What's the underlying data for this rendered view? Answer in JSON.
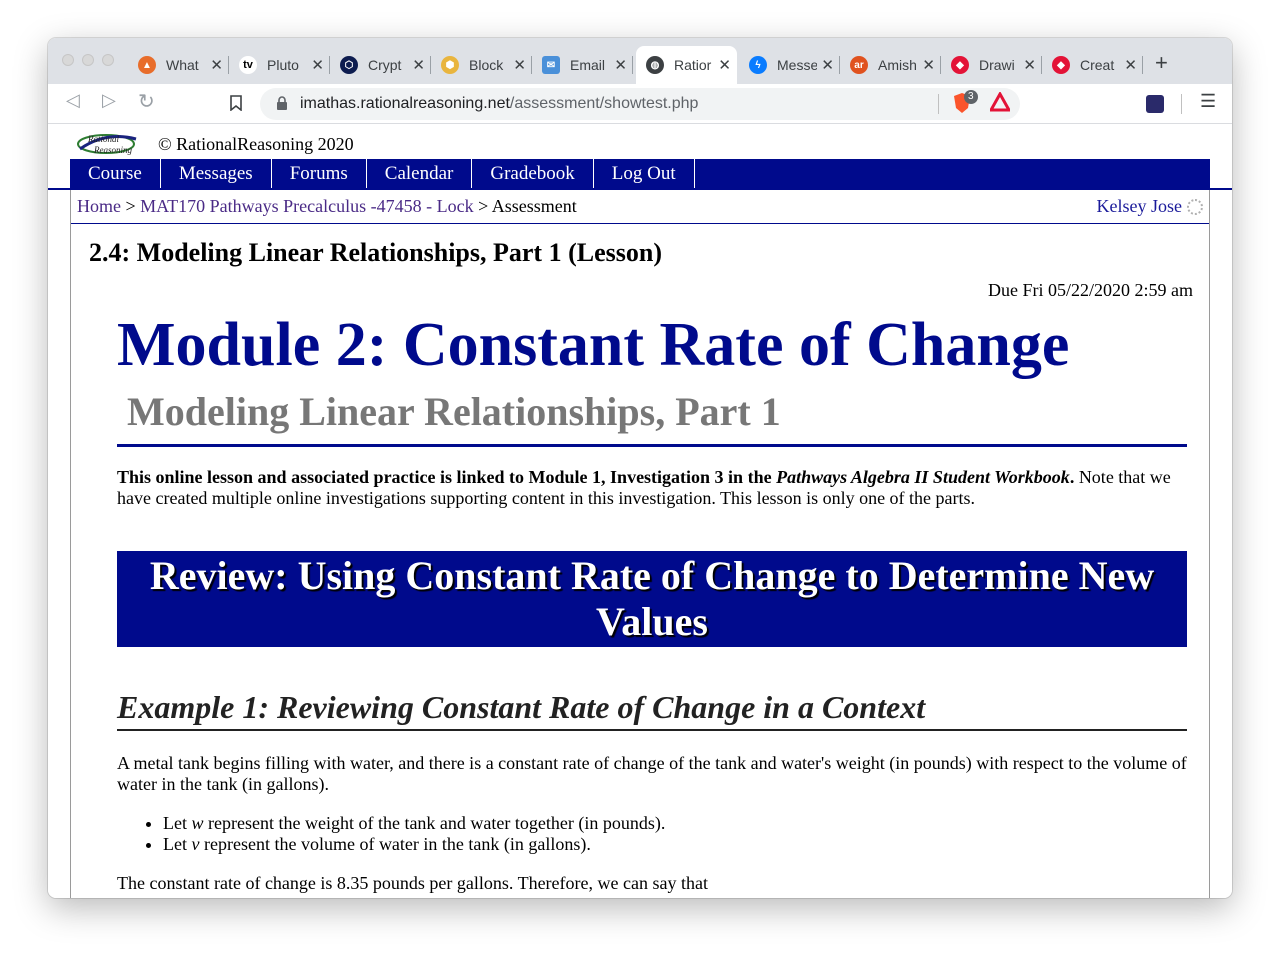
{
  "browser": {
    "tabs": [
      {
        "title": "What",
        "icon": "what-favicon",
        "color": "#e86d2b"
      },
      {
        "title": "Pluto",
        "icon": "pluto-tv-favicon",
        "color": "#000000"
      },
      {
        "title": "Crypt",
        "icon": "crypto-favicon",
        "color": "#0d1c4f"
      },
      {
        "title": "Block",
        "icon": "block-favicon",
        "color": "#e9b53e"
      },
      {
        "title": "Email",
        "icon": "email-favicon",
        "color": "#4a90d9"
      },
      {
        "title": "Ratior",
        "icon": "globe-favicon",
        "color": "#3c4043"
      },
      {
        "title": "Messe",
        "icon": "messenger-favicon",
        "color": "#0a7cff"
      },
      {
        "title": "Amish",
        "icon": "amish-favicon",
        "color": "#e0521f"
      },
      {
        "title": "Drawi",
        "icon": "hive-favicon",
        "color": "#e31337"
      },
      {
        "title": "Creat",
        "icon": "hive-favicon",
        "color": "#e31337"
      }
    ],
    "new_tab": "+",
    "url_host": "imathas.rationalreasoning.net",
    "url_path": "/assessment/showtest.php",
    "brave_badge": "3"
  },
  "site": {
    "logo_text": "Rational Reasoning",
    "copyright": "© RationalReasoning 2020",
    "nav": [
      "Course",
      "Messages",
      "Forums",
      "Calendar",
      "Gradebook",
      "Log Out"
    ],
    "breadcrumb": {
      "home": "Home",
      "sep": ">",
      "course": "MAT170 Pathways Precalculus -47458 - Lock",
      "current": "Assessment"
    },
    "user_name": "Kelsey Jose"
  },
  "assessment": {
    "title": "2.4: Modeling Linear Relationships, Part 1 (Lesson)",
    "due": "Due Fri 05/22/2020 2:59 am"
  },
  "lesson": {
    "module_title": "Module 2: Constant Rate of Change",
    "subtitle": "Modeling Linear Relationships, Part 1",
    "intro_bold": "This online lesson and associated practice is linked to Module 1, Investigation 3 in the ",
    "intro_book": "Pathways Algebra II Student Workbook",
    "intro_period": ".",
    "intro_rest": " Note that we have created multiple online investigations supporting content in this investigation. This lesson is only one of the parts.",
    "review_heading": "Review: Using Constant Rate of Change to Determine New Values",
    "example_heading": "Example 1: Reviewing Constant Rate of Change in a Context",
    "paragraph": "A metal tank begins filling with water, and there is a constant rate of change of the tank and water's weight (in pounds) with respect to the volume of water in the tank (in gallons).",
    "bullet_w_pre": "Let ",
    "bullet_w_var": "w",
    "bullet_w_post": " represent the weight of the tank and water together (in pounds).",
    "bullet_v_pre": "Let ",
    "bullet_v_var": "v",
    "bullet_v_post": " represent the volume of water in the tank (in gallons).",
    "rate_sentence": "The constant rate of change is 8.35 pounds per gallons. Therefore, we can say that"
  },
  "colors": {
    "nav_blue": "#000a8c",
    "subtitle_gray": "#777777",
    "link_purple": "#4a2a86"
  }
}
